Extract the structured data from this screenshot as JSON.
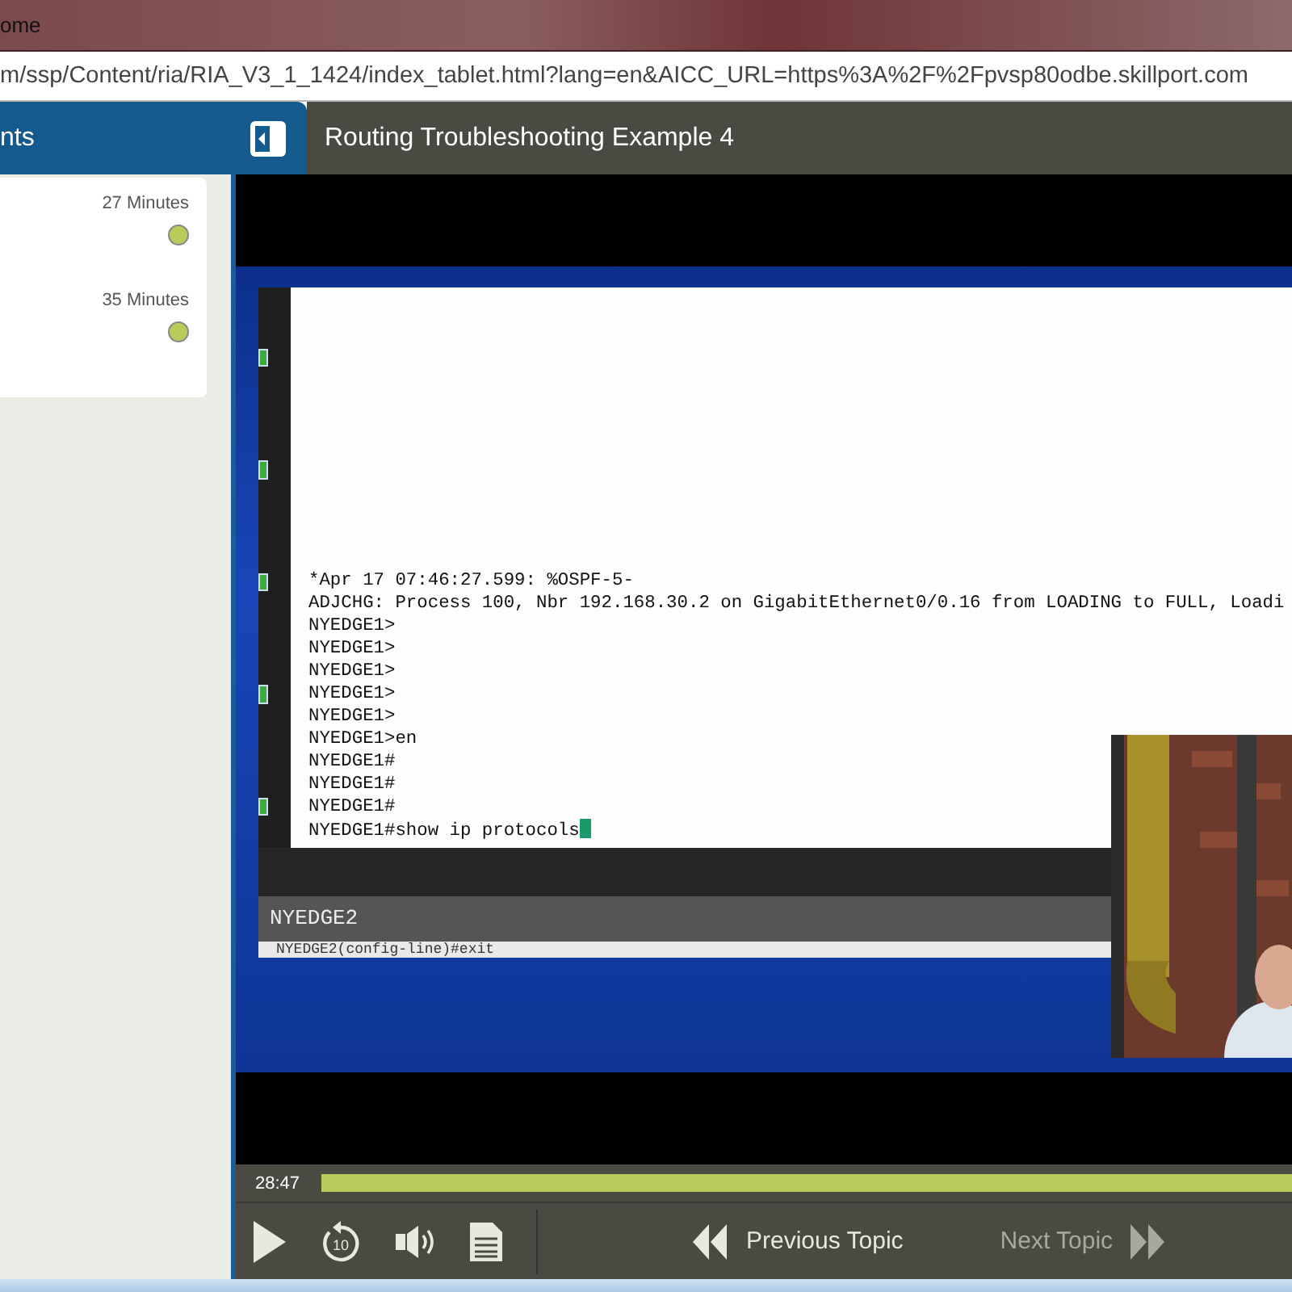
{
  "browser": {
    "title": "ome",
    "url": "m/ssp/Content/ria/RIA_V3_1_1424/index_tablet.html?lang=en&AICC_URL=https%3A%2F%2Fpvsp80odbe.skillport.com"
  },
  "sidebar": {
    "title": "nts",
    "items": [
      {
        "duration": "27 Minutes",
        "color": "#b8cc5c"
      },
      {
        "duration": "35 Minutes",
        "color": "#b8cc5c"
      }
    ]
  },
  "player": {
    "title": "Routing Troubleshooting Example 4",
    "terminal": {
      "lines": [
        "*Apr 17 07:46:27.599: %OSPF-5-",
        "ADJCHG: Process 100, Nbr 192.168.30.2 on GigabitEthernet0/0.16 from LOADING to FULL, Loadi",
        "NYEDGE1>",
        "NYEDGE1>",
        "NYEDGE1>",
        "NYEDGE1>",
        "NYEDGE1>",
        "NYEDGE1>en",
        "NYEDGE1#",
        "NYEDGE1#",
        "NYEDGE1#",
        "NYEDGE1#show ip protocols"
      ],
      "tab": "NYEDGE2",
      "tab_line": "NYEDGE2(config-line)#exit"
    },
    "time": "28:47",
    "progress": {
      "level": 1
    },
    "controls": [
      {
        "kind": "play"
      },
      {
        "kind": "replay",
        "label": "10"
      },
      {
        "kind": "volume"
      },
      {
        "kind": "transcript"
      }
    ],
    "previous": {
      "label": "Previous Topic",
      "disabled": false
    },
    "next": {
      "label": "Next Topic",
      "disabled": true
    }
  }
}
